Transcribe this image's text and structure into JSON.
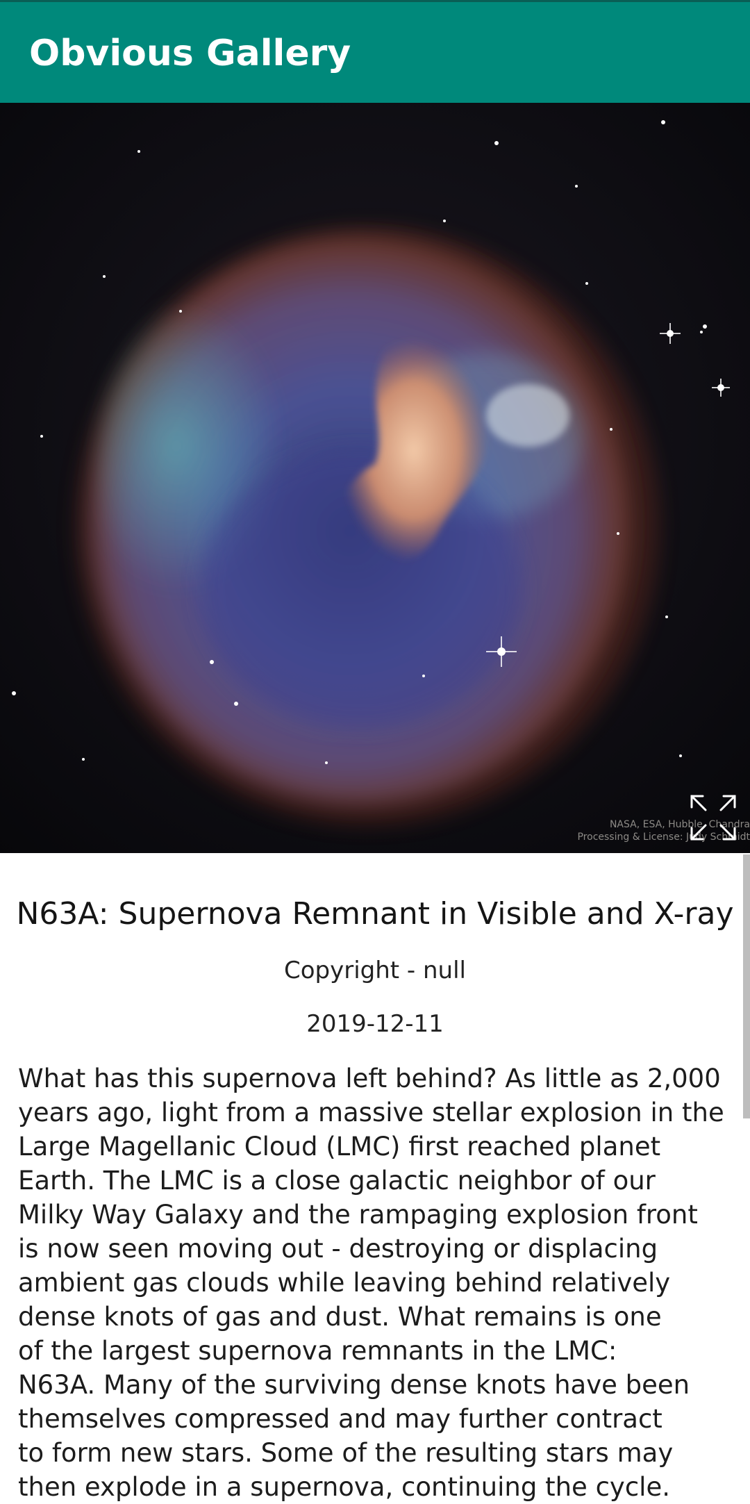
{
  "app": {
    "title": "Obvious Gallery"
  },
  "image": {
    "icon": "nebula-photo",
    "credit": "NASA, ESA, Hubble, Chandra\nProcessing & License: Judy Schmidt"
  },
  "expand_button": {
    "icon": "expand-icon"
  },
  "article": {
    "title": "N63A: Supernova Remnant in Visible and X-ray",
    "copyright": "Copyright - null",
    "date": "2019-12-11",
    "explanation": "What has this supernova left behind?  As little as 2,000\nyears ago, light from a massive stellar explosion in the\nLarge Magellanic Cloud (LMC) first reached planet\nEarth. The LMC is a close galactic neighbor of our\nMilky Way Galaxy and the rampaging explosion front\nis now seen moving out - destroying or displacing\nambient gas clouds while leaving behind relatively\ndense knots of gas and dust.  What remains is one\nof the largest supernova remnants in the LMC:\nN63A.  Many of the surviving dense knots have been\nthemselves compressed and may further contract\nto form new stars.  Some of the resulting stars may\nthen explode in a supernova, continuing the cycle."
  },
  "colors": {
    "app_bar": "#00897b",
    "background": "#ffffff"
  }
}
